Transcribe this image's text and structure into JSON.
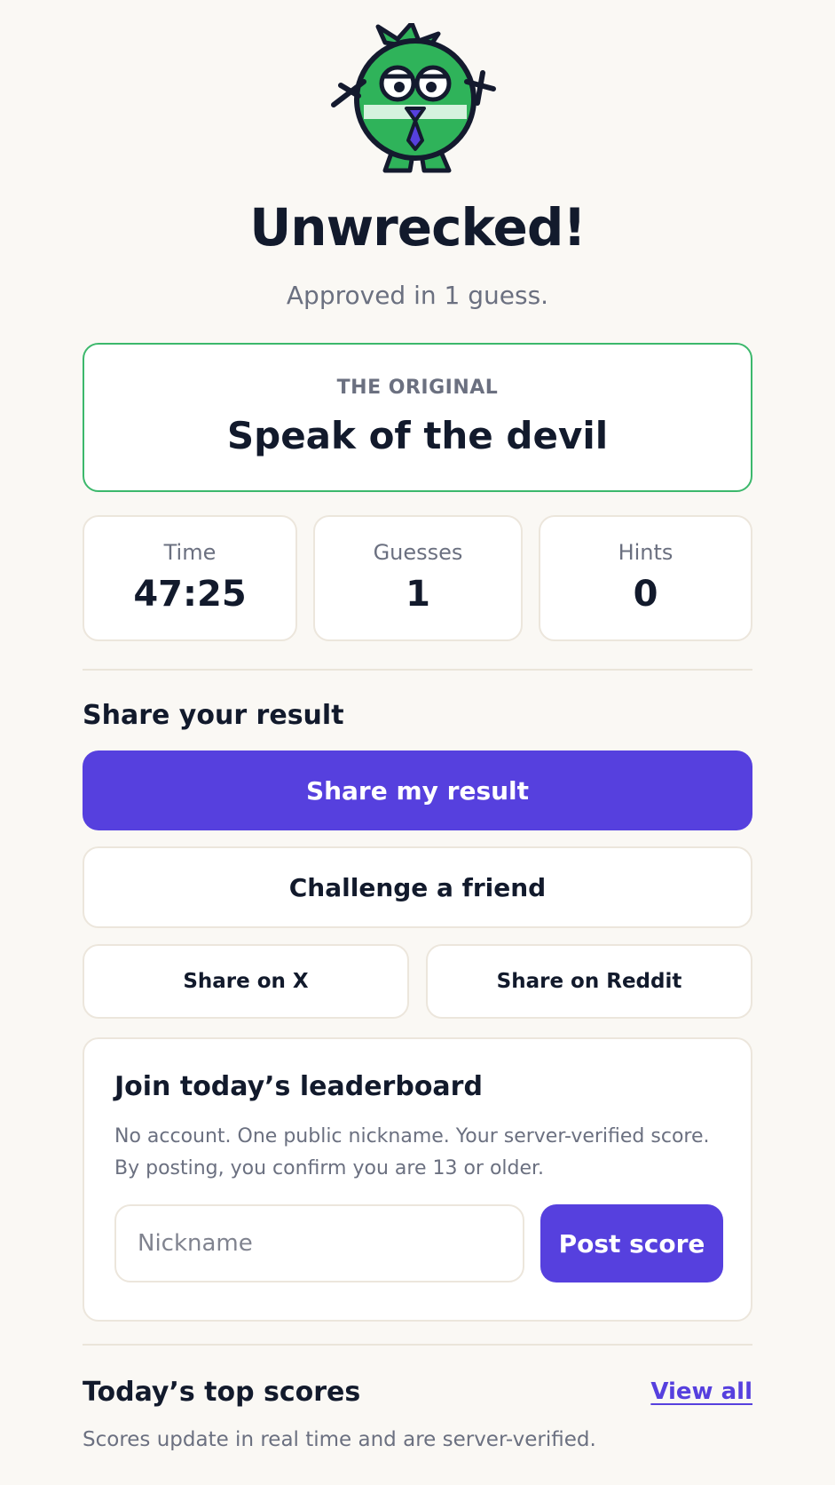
{
  "result": {
    "title": "Unwrecked!",
    "subtitle": "Approved in 1 guess."
  },
  "original": {
    "label": "THE ORIGINAL",
    "phrase": "Speak of the devil"
  },
  "stats": [
    {
      "label": "Time",
      "value": "47:25"
    },
    {
      "label": "Guesses",
      "value": "1"
    },
    {
      "label": "Hints",
      "value": "0"
    }
  ],
  "share": {
    "heading": "Share your result",
    "primary_label": "Share my result",
    "challenge_label": "Challenge a friend",
    "x_label": "Share on X",
    "reddit_label": "Share on Reddit"
  },
  "leaderboard": {
    "heading": "Join today’s leaderboard",
    "description": "No account. One public nickname. Your server-verified score. By posting, you confirm you are 13 or older.",
    "nickname_placeholder": "Nickname",
    "nickname_value": "",
    "post_label": "Post score"
  },
  "top_scores": {
    "heading": "Today’s top scores",
    "view_all_label": "View all",
    "note": "Scores update in real time and are server-verified."
  },
  "colors": {
    "accent": "#5640de",
    "success_border": "#3cb86c",
    "mascot_green": "#2fb35a",
    "background": "#faf8f4"
  },
  "icons": {
    "mascot": "green-monster-mascot"
  }
}
